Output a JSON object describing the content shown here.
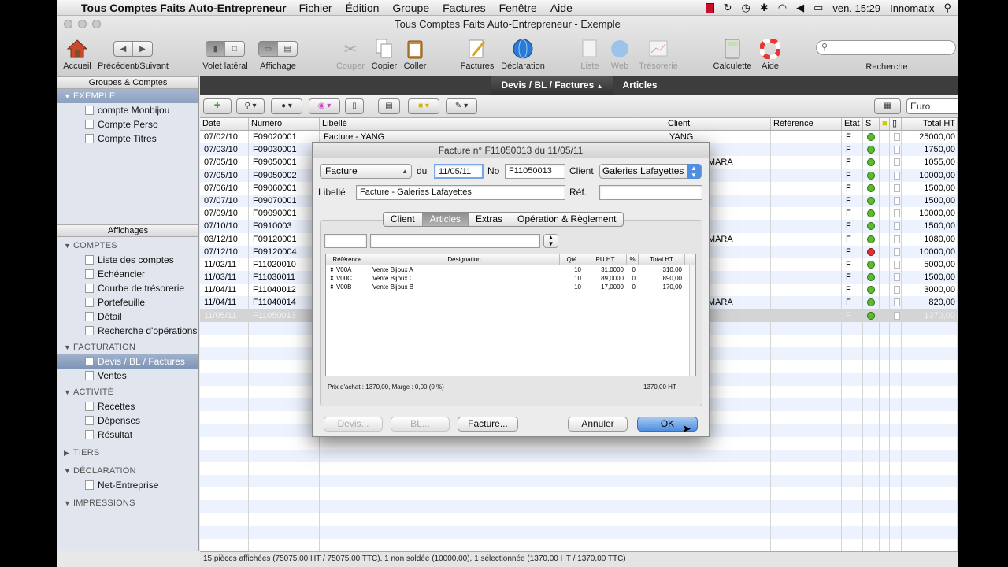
{
  "menubar": {
    "app_name": "Tous Comptes Faits Auto-Entrepreneur",
    "menus": [
      "Fichier",
      "Édition",
      "Groupe",
      "Factures",
      "Fenêtre",
      "Aide"
    ],
    "clock": "ven. 15:29",
    "user": "Innomatix"
  },
  "window": {
    "title": "Tous Comptes Faits Auto-Entrepreneur - Exemple"
  },
  "toolbar": {
    "accueil": "Accueil",
    "nav": "Précédent/Suivant",
    "volet": "Volet latéral",
    "affichage": "Affichage",
    "couper": "Couper",
    "copier": "Copier",
    "coller": "Coller",
    "factures": "Factures",
    "declaration": "Déclaration",
    "liste": "Liste",
    "web": "Web",
    "tresorerie": "Trésorerie",
    "calculette": "Calculette",
    "aide": "Aide",
    "recherche": "Recherche"
  },
  "sidebar": {
    "groups_header": "Groupes & Comptes",
    "group_name": "EXEMPLE",
    "accounts": [
      "compte Monbijou",
      "Compte Perso",
      "Compte Titres"
    ],
    "views_header": "Affichages",
    "sections": {
      "comptes": "COMPTES",
      "comptes_items": [
        "Liste des comptes",
        "Echéancier",
        "Courbe de trésorerie",
        "Portefeuille",
        "Détail",
        "Recherche d'opérations"
      ],
      "facturation": "FACTURATION",
      "facturation_items": [
        "Devis / BL / Factures",
        "Ventes"
      ],
      "activite": "ACTIVITÉ",
      "activite_items": [
        "Recettes",
        "Dépenses",
        "Résultat"
      ],
      "tiers": "TIERS",
      "declaration": "DÉCLARATION",
      "declaration_items": [
        "Net-Entreprise"
      ],
      "impressions": "IMPRESSIONS"
    }
  },
  "tabs": [
    "Devis / BL / Factures",
    "Articles"
  ],
  "currency": "Euro",
  "table": {
    "columns": [
      "Date",
      "Numéro",
      "Libellé",
      "Client",
      "Référence",
      "Etat",
      "S",
      "",
      "",
      "Total HT"
    ],
    "rows": [
      {
        "date": "07/02/10",
        "num": "F09020001",
        "lib": "Facture - YANG",
        "client": "YANG",
        "etat": "F",
        "total": "25000,00",
        "st": "g"
      },
      {
        "date": "07/03/10",
        "num": "F09030001",
        "lib": "",
        "client": "u Mékong",
        "etat": "F",
        "total": "1750,00",
        "st": "g"
      },
      {
        "date": "07/05/10",
        "num": "F09050001",
        "lib": "",
        "client": "LLES DU MARA",
        "etat": "F",
        "total": "1055,00",
        "st": "g"
      },
      {
        "date": "07/05/10",
        "num": "F09050002",
        "lib": "",
        "client": "",
        "etat": "F",
        "total": "10000,00",
        "st": "g"
      },
      {
        "date": "07/06/10",
        "num": "F09060001",
        "lib": "",
        "client": "u Mékong",
        "etat": "F",
        "total": "1500,00",
        "st": "g"
      },
      {
        "date": "07/07/10",
        "num": "F09070001",
        "lib": "",
        "client": "u Mékong",
        "etat": "F",
        "total": "1500,00",
        "st": "g"
      },
      {
        "date": "07/09/10",
        "num": "F09090001",
        "lib": "",
        "client": "",
        "etat": "F",
        "total": "10000,00",
        "st": "g"
      },
      {
        "date": "07/10/10",
        "num": "F0910003",
        "lib": "",
        "client": "",
        "etat": "F",
        "total": "1500,00",
        "st": "g"
      },
      {
        "date": "03/12/10",
        "num": "F09120001",
        "lib": "",
        "client": "LLES DU MARA",
        "etat": "F",
        "total": "1080,00",
        "st": "g"
      },
      {
        "date": "07/12/10",
        "num": "F09120004",
        "lib": "",
        "client": "",
        "etat": "F",
        "total": "10000,00",
        "st": "r"
      },
      {
        "date": "11/02/11",
        "num": "F11020010",
        "lib": "",
        "client": "",
        "etat": "F",
        "total": "5000,00",
        "st": "g"
      },
      {
        "date": "11/03/11",
        "num": "F11030011",
        "lib": "",
        "client": "u Mékong",
        "etat": "F",
        "total": "1500,00",
        "st": "g"
      },
      {
        "date": "11/04/11",
        "num": "F11040012",
        "lib": "",
        "client": "",
        "etat": "F",
        "total": "3000,00",
        "st": "g"
      },
      {
        "date": "11/04/11",
        "num": "F11040014",
        "lib": "",
        "client": "LLES DU MARA",
        "etat": "F",
        "total": "820,00",
        "st": "g"
      },
      {
        "date": "11/05/11",
        "num": "F11050013",
        "lib": "",
        "client": "afayettes",
        "etat": "F",
        "total": "1370,00",
        "st": "g"
      }
    ]
  },
  "status": "15 pièces affichées (75075,00 HT / 75075,00 TTC), 1 non soldée (10000,00), 1 sélectionnée (1370,00 HT / 1370,00 TTC)",
  "dialog": {
    "title": "Facture n° F11050013 du 11/05/11",
    "type": "Facture",
    "du_label": "du",
    "date": "11/05/11",
    "no_label": "No",
    "number": "F11050013",
    "client_label": "Client",
    "client": "Galeries Lafayettes",
    "libelle_label": "Libellé",
    "libelle": "Facture - Galeries Lafayettes",
    "ref_label": "Réf.",
    "ref": "",
    "tabs": [
      "Client",
      "Articles",
      "Extras",
      "Opération & Règlement"
    ],
    "items_columns": [
      "Référence",
      "Désignation",
      "Qté",
      "PU HT",
      "%",
      "Total HT"
    ],
    "items": [
      {
        "ref": "V00A",
        "des": "Vente Bijoux A",
        "qte": "10",
        "pu": "31,0000",
        "pct": "0",
        "total": "310,00"
      },
      {
        "ref": "V00C",
        "des": "Vente Bijoux C",
        "qte": "10",
        "pu": "89,0000",
        "pct": "0",
        "total": "890,00"
      },
      {
        "ref": "V00B",
        "des": "Vente Bijoux B",
        "qte": "10",
        "pu": "17,0000",
        "pct": "0",
        "total": "170,00"
      }
    ],
    "summary": "Prix d'achat : 1370,00, Marge : 0,00 (0 %)",
    "total": "1370,00 HT",
    "btn_devis": "Devis...",
    "btn_bl": "BL...",
    "btn_facture": "Facture...",
    "btn_annuler": "Annuler",
    "btn_ok": "OK"
  }
}
